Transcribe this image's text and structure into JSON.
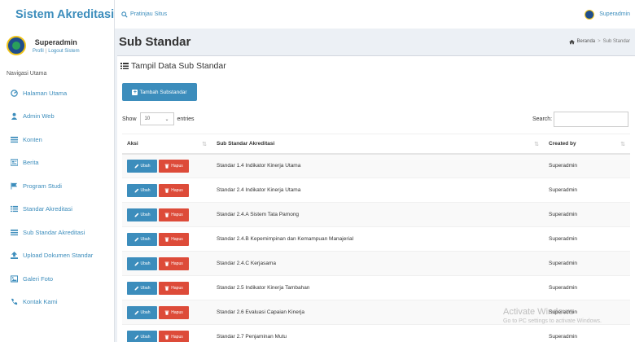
{
  "app": {
    "brand": "Sistem Akreditasi",
    "preview_label": "Pratinjau Situs",
    "top_user": "Superadmin"
  },
  "sidebar": {
    "user_name": "Superadmin",
    "profile_link": "Profil",
    "logout_link": "Logout Sistem",
    "nav_header": "Navigasi Utama",
    "items": [
      {
        "label": "Halaman Utama",
        "icon": "dashboard-icon"
      },
      {
        "label": "Admin Web",
        "icon": "user-icon"
      },
      {
        "label": "Konten",
        "icon": "list-icon"
      },
      {
        "label": "Berita",
        "icon": "newspaper-icon"
      },
      {
        "label": "Program Studi",
        "icon": "flag-icon"
      },
      {
        "label": "Standar Akreditasi",
        "icon": "list-icon"
      },
      {
        "label": "Sub Standar Akreditasi",
        "icon": "list-icon"
      },
      {
        "label": "Upload Dokumen Standar",
        "icon": "upload-icon"
      },
      {
        "label": "Galeri Foto",
        "icon": "image-icon"
      },
      {
        "label": "Kontak Kami",
        "icon": "phone-icon"
      }
    ]
  },
  "header": {
    "title": "Sub Standar",
    "breadcrumb_home": "Beranda",
    "breadcrumb_current": "Sub Standar"
  },
  "box": {
    "title": "Tampil Data Sub Standar",
    "add_button": "Tambah Substandar",
    "show_label": "Show",
    "entries_value": "10",
    "entries_label": "entries",
    "search_label": "Search:",
    "search_value": ""
  },
  "table": {
    "headers": [
      "Aksi",
      "Sub Standar Akreditasi",
      "Created by"
    ],
    "edit_label": "Ubah",
    "delete_label": "Hapus",
    "rows": [
      {
        "name": "Standar 1.4 Indikator Kinerja Utama",
        "created_by": "Superadmin"
      },
      {
        "name": "Standar 2.4 Indikator Kinerja Utama",
        "created_by": "Superadmin"
      },
      {
        "name": "Standar 2.4.A Sistem Tata Pamong",
        "created_by": "Superadmin"
      },
      {
        "name": "Standar 2.4.B Kepemimpinan dan Kemampuan Manajerial",
        "created_by": "Superadmin"
      },
      {
        "name": "Standar 2.4.C Kerjasama",
        "created_by": "Superadmin"
      },
      {
        "name": "Standar 2.5 Indikator Kinerja Tambahan",
        "created_by": "Superadmin"
      },
      {
        "name": "Standar 2.6 Evaluasi Capaian Kinerja",
        "created_by": "Superadmin"
      },
      {
        "name": "Standar 2.7 Penjaminan Mutu",
        "created_by": "Superadmin"
      }
    ]
  },
  "watermark": {
    "line1": "Activate Windows",
    "line2": "Go to PC settings to activate Windows."
  },
  "colors": {
    "primary": "#3c8dbc",
    "danger": "#dd4b39",
    "background": "#ecf0f5"
  }
}
